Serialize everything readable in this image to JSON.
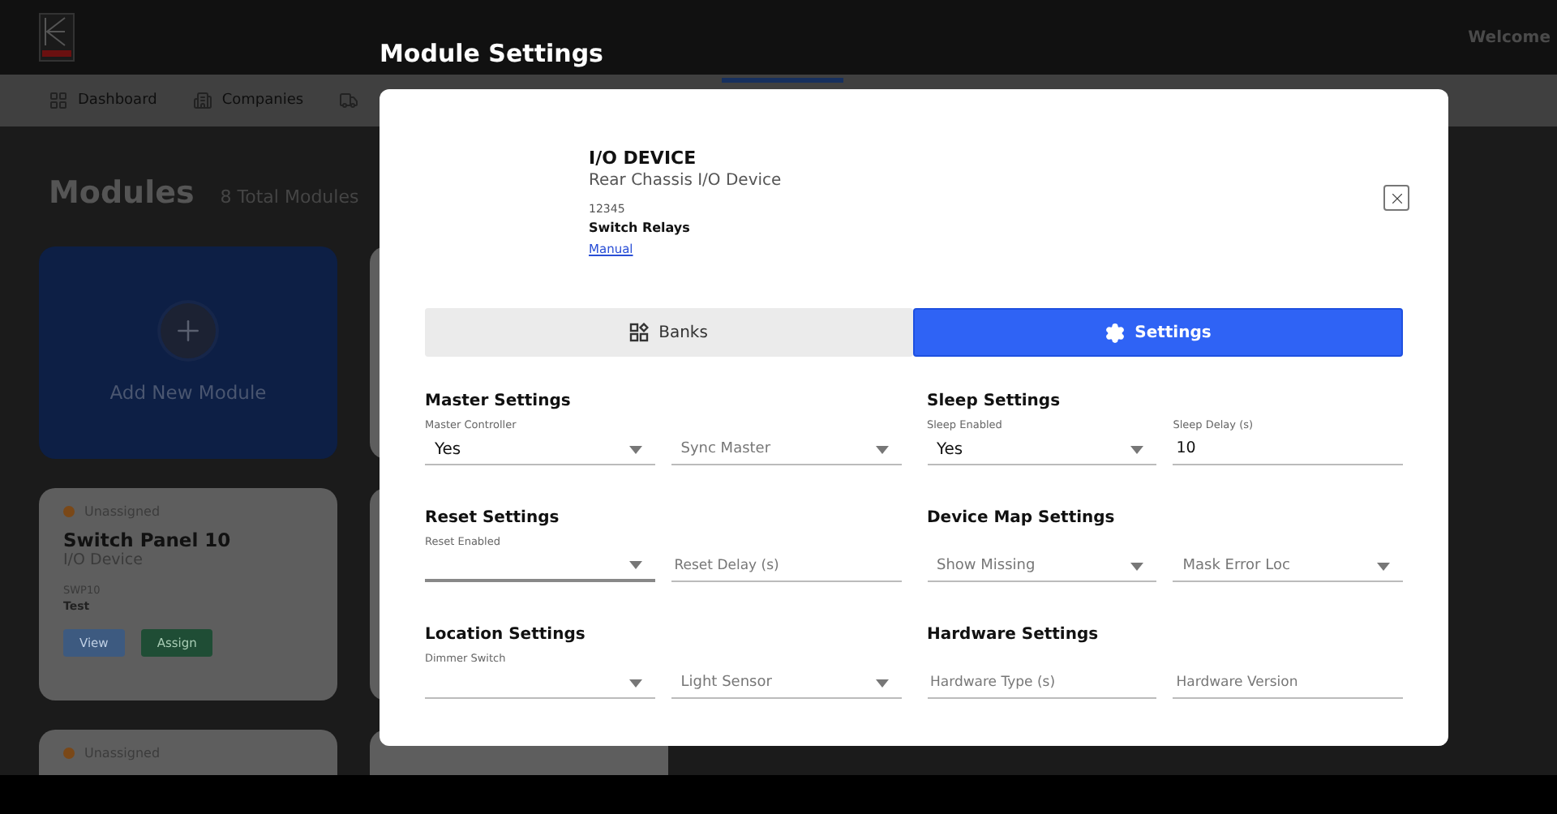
{
  "header": {
    "welcome": "Welcome"
  },
  "nav": {
    "items": [
      {
        "label": "Dashboard"
      },
      {
        "label": "Companies"
      }
    ]
  },
  "page": {
    "title": "Modules",
    "count": "8 Total Modules"
  },
  "add_card": {
    "label": "Add New Module"
  },
  "module_cards": [
    {
      "status": "Unassigned",
      "color": "#7a4818",
      "name": "Switch Panel 10",
      "type": "I/O Device",
      "code": "SWP10",
      "note": "Test",
      "buttons": [
        "View",
        "Assign"
      ]
    },
    {
      "status": "Unassigned",
      "color": "#7a4818"
    }
  ],
  "modal": {
    "title": "Module Settings",
    "device": {
      "kind": "I/O DEVICE",
      "name": "Rear Chassis I/O Device",
      "serial": "12345",
      "category": "Switch Relays",
      "link": "Manual"
    },
    "tabs": [
      {
        "label": "Banks",
        "selected": false
      },
      {
        "label": "Settings",
        "selected": true
      }
    ],
    "sections": [
      {
        "title": "Master Settings",
        "fields": [
          {
            "kind": "select",
            "label": "Master Controller",
            "value": "Yes"
          },
          {
            "kind": "select",
            "placeholder": "Sync Master"
          }
        ]
      },
      {
        "title": "Sleep Settings",
        "fields": [
          {
            "kind": "select",
            "label": "Sleep Enabled",
            "value": "Yes"
          },
          {
            "kind": "text",
            "label": "Sleep Delay (s)",
            "value": "10"
          }
        ]
      },
      {
        "title": "Reset Settings",
        "fields": [
          {
            "kind": "select",
            "label": "Reset Enabled",
            "focused": true
          },
          {
            "kind": "text",
            "placeholder": "Reset Delay (s)"
          }
        ]
      },
      {
        "title": "Device Map Settings",
        "fields": [
          {
            "kind": "select",
            "placeholder": "Show Missing"
          },
          {
            "kind": "select",
            "placeholder": "Mask Error Loc"
          }
        ]
      },
      {
        "title": "Location Settings",
        "fields": [
          {
            "kind": "select",
            "label": "Dimmer Switch"
          },
          {
            "kind": "select",
            "placeholder": "Light Sensor"
          }
        ]
      },
      {
        "title": "Hardware Settings",
        "fields": [
          {
            "kind": "text",
            "placeholder": "Hardware Type (s)"
          },
          {
            "kind": "text",
            "placeholder": "Hardware Version"
          }
        ]
      }
    ]
  }
}
